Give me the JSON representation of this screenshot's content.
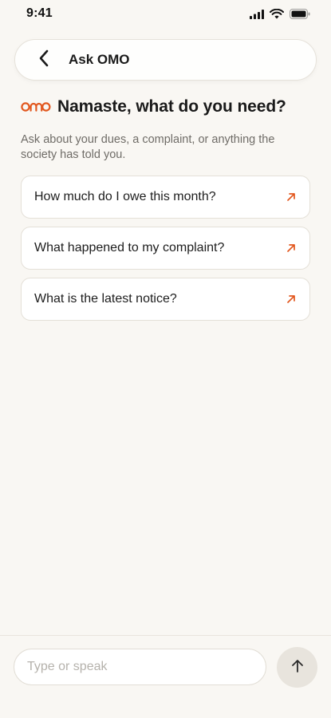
{
  "status_bar": {
    "time": "9:41"
  },
  "header": {
    "title": "Ask OMO",
    "back_icon": "chevron-left-icon"
  },
  "brand": {
    "logo_text": "omo",
    "accent_color": "#e2581f"
  },
  "greeting": {
    "title": "Namaste, what do you need?",
    "subtitle": "Ask about your dues, a complaint, or anything the society has told you."
  },
  "suggestions": [
    {
      "label": "How much do I owe this month?",
      "icon": "arrow-up-right-icon"
    },
    {
      "label": "What happened to my complaint?",
      "icon": "arrow-up-right-icon"
    },
    {
      "label": "What is the latest notice?",
      "icon": "arrow-up-right-icon"
    }
  ],
  "composer": {
    "placeholder": "Type or speak",
    "value": "",
    "send_icon": "arrow-up-icon"
  }
}
